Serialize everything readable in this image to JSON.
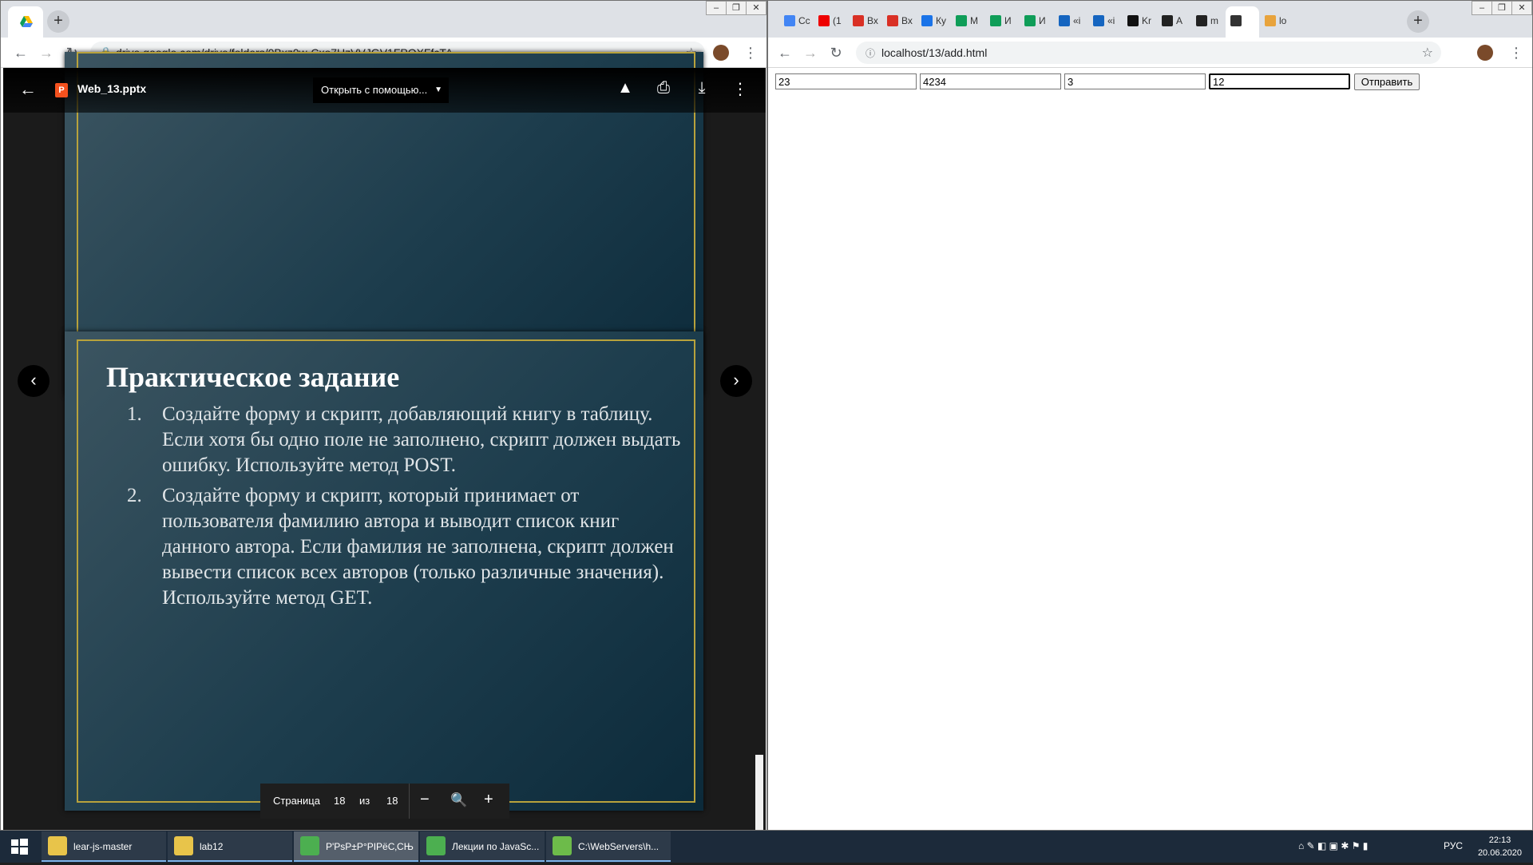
{
  "left_window": {
    "tab_title": "",
    "url": "drive.google.com/drive/folders/0Bxz0w-Cxo7UzVVJGV1FPOXFfcTA",
    "window_controls": [
      "–",
      "❐",
      "✕"
    ]
  },
  "viewer": {
    "file_name": "Web_13.pptx",
    "file_icon_letter": "P",
    "open_with_label": "Открыть с помощью...",
    "pager": {
      "label": "Страница",
      "current": "18",
      "of_label": "из",
      "total": "18"
    }
  },
  "slide": {
    "title": "Практическое задание",
    "items": [
      {
        "num": "1.",
        "text": "Создайте форму и скрипт, добавляющий книгу в таблицу. Если хотя бы одно поле не заполнено, скрипт должен выдать ошибку. Используйте метод POST."
      },
      {
        "num": "2.",
        "text": "Создайте форму и скрипт, который принимает от пользователя фамилию автора и выводит список книг данного автора. Если фамилия не заполнена, скрипт должен вывести список всех авторов (только различные значения). Используйте метод GET."
      }
    ]
  },
  "right_window": {
    "url": "localhost/13/add.html",
    "tabs": [
      "Cc",
      "(1",
      "Вх",
      "Вх",
      "Ку",
      "М",
      "И",
      "И",
      "«i",
      "«i",
      "Kr",
      "A",
      "m",
      "",
      "lo"
    ],
    "window_controls": [
      "–",
      "❐",
      "✕"
    ]
  },
  "form": {
    "fields": [
      "23",
      "4234",
      "3",
      "12"
    ],
    "submit_label": "Отправить"
  },
  "taskbar": {
    "tasks": [
      {
        "label": "lear-js-master",
        "color": "#e8c44a"
      },
      {
        "label": "lab12",
        "color": "#e8c44a"
      },
      {
        "label": "Р'РѕР±Р°РІРёС‚СЊ...",
        "color": "#4caf50"
      },
      {
        "label": "Лекции по JavaSc...",
        "color": "#4caf50"
      },
      {
        "label": "C:\\WebServers\\h...",
        "color": "#6dbb4a"
      }
    ],
    "lang": "РУС",
    "time": "22:13",
    "date": "20.06.2020"
  }
}
